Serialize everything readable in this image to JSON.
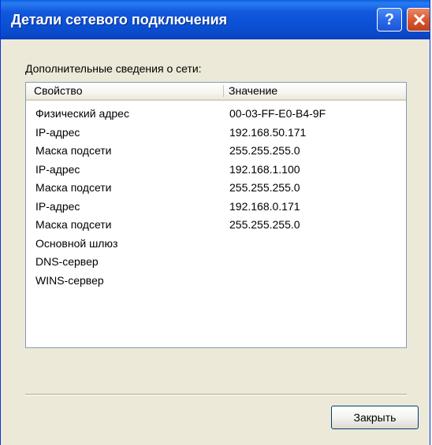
{
  "window": {
    "title": "Детали сетевого подключения",
    "help_label": "?",
    "close_glyph": "✕"
  },
  "section_label": "Дополнительные сведения о сети:",
  "list": {
    "columns": [
      "Свойство",
      "Значение"
    ],
    "rows": [
      {
        "property": "Физический адрес",
        "value": "00-03-FF-E0-B4-9F"
      },
      {
        "property": "IP-адрес",
        "value": "192.168.50.171"
      },
      {
        "property": "Маска подсети",
        "value": "255.255.255.0"
      },
      {
        "property": "IP-адрес",
        "value": "192.168.1.100"
      },
      {
        "property": "Маска подсети",
        "value": "255.255.255.0"
      },
      {
        "property": "IP-адрес",
        "value": "192.168.0.171"
      },
      {
        "property": "Маска подсети",
        "value": "255.255.255.0"
      },
      {
        "property": "Основной шлюз",
        "value": ""
      },
      {
        "property": "DNS-сервер",
        "value": ""
      },
      {
        "property": "WINS-сервер",
        "value": ""
      }
    ]
  },
  "footer": {
    "close_label": "Закрыть"
  }
}
